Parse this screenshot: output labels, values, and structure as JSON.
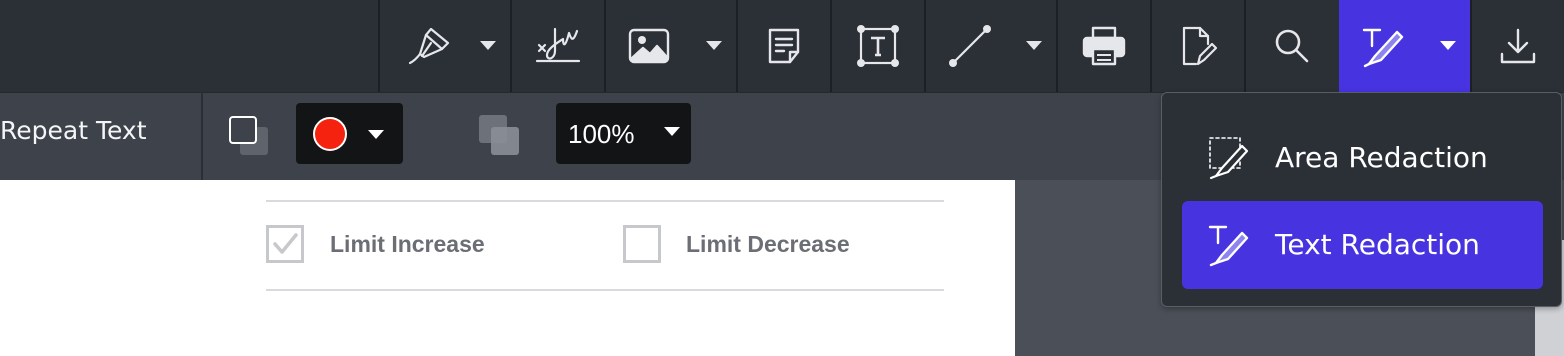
{
  "toolbar": {
    "tools": [
      {
        "name": "freehand-tool",
        "icon": "pen-nib-icon",
        "has_caret": true
      },
      {
        "name": "signature-tool",
        "icon": "signature-icon",
        "has_caret": false
      },
      {
        "name": "image-tool",
        "icon": "image-icon",
        "has_caret": true
      },
      {
        "name": "note-tool",
        "icon": "note-icon",
        "has_caret": false
      },
      {
        "name": "text-box-tool",
        "icon": "text-box-icon",
        "has_caret": false
      },
      {
        "name": "line-tool",
        "icon": "line-icon",
        "has_caret": true
      },
      {
        "name": "print-tool",
        "icon": "printer-icon",
        "has_caret": false
      },
      {
        "name": "edit-document-tool",
        "icon": "edit-document-icon",
        "has_caret": false
      },
      {
        "name": "search-tool",
        "icon": "search-icon",
        "has_caret": false
      },
      {
        "name": "redaction-tool",
        "icon": "text-redaction-icon",
        "has_caret": true,
        "active": true
      },
      {
        "name": "download-tool",
        "icon": "download-icon",
        "has_caret": false
      }
    ]
  },
  "subbar": {
    "repeat_text_label": "Repeat Text",
    "fill_color": "#f5220f",
    "zoom_value": "100%"
  },
  "document": {
    "checkbox_1": {
      "label": "Limit Increase",
      "checked": true
    },
    "checkbox_2": {
      "label": "Limit Decrease",
      "checked": false
    }
  },
  "redaction_menu": {
    "items": [
      {
        "label": "Area Redaction",
        "icon": "area-redaction-icon",
        "selected": false
      },
      {
        "label": "Text Redaction",
        "icon": "text-redaction-icon",
        "selected": true
      }
    ]
  },
  "colors": {
    "accent": "#4733e0",
    "toolbar_bg": "#2b2f36",
    "subbar_bg": "#3e434b"
  }
}
